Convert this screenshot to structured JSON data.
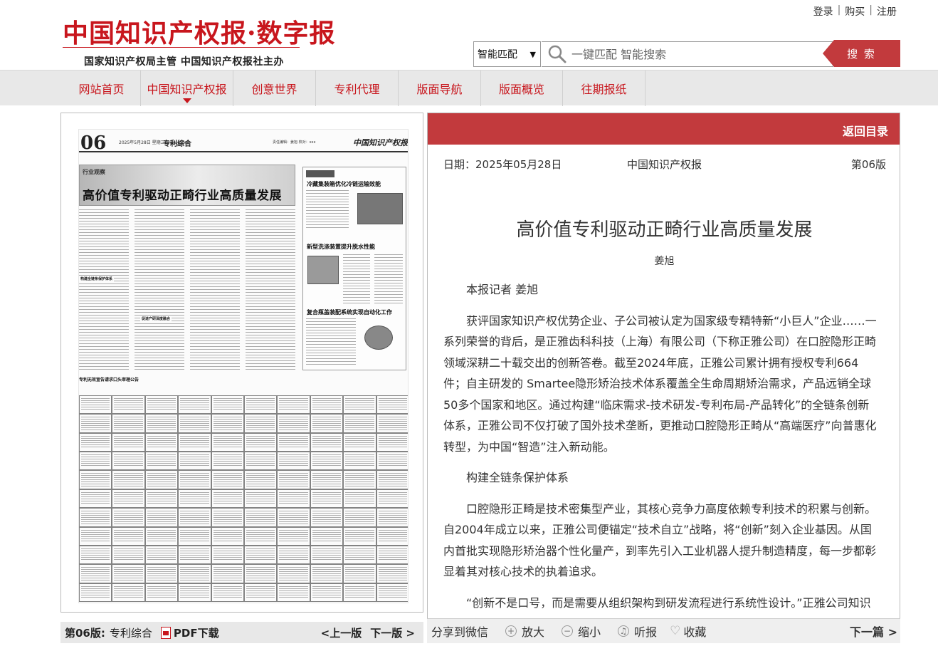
{
  "header": {
    "logo_text": "中国知识产权报·数字报",
    "subtitle": "国家知识产权局主管  中国知识产权报社主办",
    "user_links": [
      "登录",
      "购买",
      "注册"
    ]
  },
  "search": {
    "mode": "智能匹配",
    "placeholder": "一键匹配 智能搜索",
    "button": "搜 索"
  },
  "nav": {
    "items": [
      "网站首页",
      "中国知识产权报",
      "创意世界",
      "专利代理",
      "版面导航",
      "版面概览",
      "往期报纸"
    ],
    "active_index": 1
  },
  "paper": {
    "page_number": "06",
    "date_line": "2025年5月28日  星期三  www.ipr.cn",
    "section": "专利综合",
    "editors": "责任编辑：姜旭  校对：xxx",
    "mini_logo": "中国知识产权报",
    "banner_tag": "行业观察",
    "headline": "高价值专利驱动正畸行业高质量发展",
    "side_titles": [
      "冷藏集装箱优化冷链运输效能",
      "新型洗涤装置提升脱水性能",
      "复合瓶盖装配系统实现自动化工作"
    ],
    "subheads": [
      "构建全链条保护体系",
      "促进产研深度融合"
    ],
    "ad_title": "专利无效宣告请求口头审理公告"
  },
  "left_bar": {
    "page_label": "第06版:",
    "page_name": "专利综合",
    "pdf": "PDF下载",
    "prev": "<上一版",
    "next": "下一版 >"
  },
  "article": {
    "back": "返回目录",
    "date": "日期：2025年05月28日",
    "publication": "中国知识产权报",
    "edition": "第06版",
    "title": "高价值专利驱动正畸行业高质量发展",
    "author": "姜旭",
    "paragraphs": [
      "本报记者 姜旭",
      "获评国家知识产权优势企业、子公司被认定为国家级专精特新“小巨人”企业……一系列荣誉的背后，是正雅齿科科技（上海）有限公司（下称正雅公司）在口腔隐形正畸领域深耕二十载交出的创新答卷。截至2024年底，正雅公司累计拥有授权专利664件；自主研发的 Smartee隐形矫治技术体系覆盖全生命周期矫治需求，产品远销全球50多个国家和地区。通过构建“临床需求-技术研发-专利布局-产品转化”的全链条创新体系，正雅公司不仅打破了国外技术垄断，更推动口腔隐形正畸从“高端医疗”向普惠化转型，为中国“智造”注入新动能。",
      "构建全链条保护体系",
      "口腔隐形正畸是技术密集型产业，其核心竞争力高度依赖专利技术的积累与创新。自2004年成立以来，正雅公司便锚定“技术自立”战略，将“创新”刻入企业基因。从国内首批实现隐形矫治器个性化量产，到率先引入工业机器人提升制造精度，每一步都彰显着其对核心技术的执着追求。",
      "“创新不是口号，而是需要从组织架构到研发流程进行系统性设计。”正雅公司知识产权负责人介绍。"
    ]
  },
  "tools": {
    "share": "分享到微信",
    "zoom_in": "放大",
    "zoom_out": "缩小",
    "listen": "听报",
    "favorite": "收藏",
    "next_article": "下一篇 >"
  },
  "colors": {
    "brand_red": "#c8161d",
    "bar_red": "#c23a3d",
    "nav_bg": "#e8e8e8"
  }
}
